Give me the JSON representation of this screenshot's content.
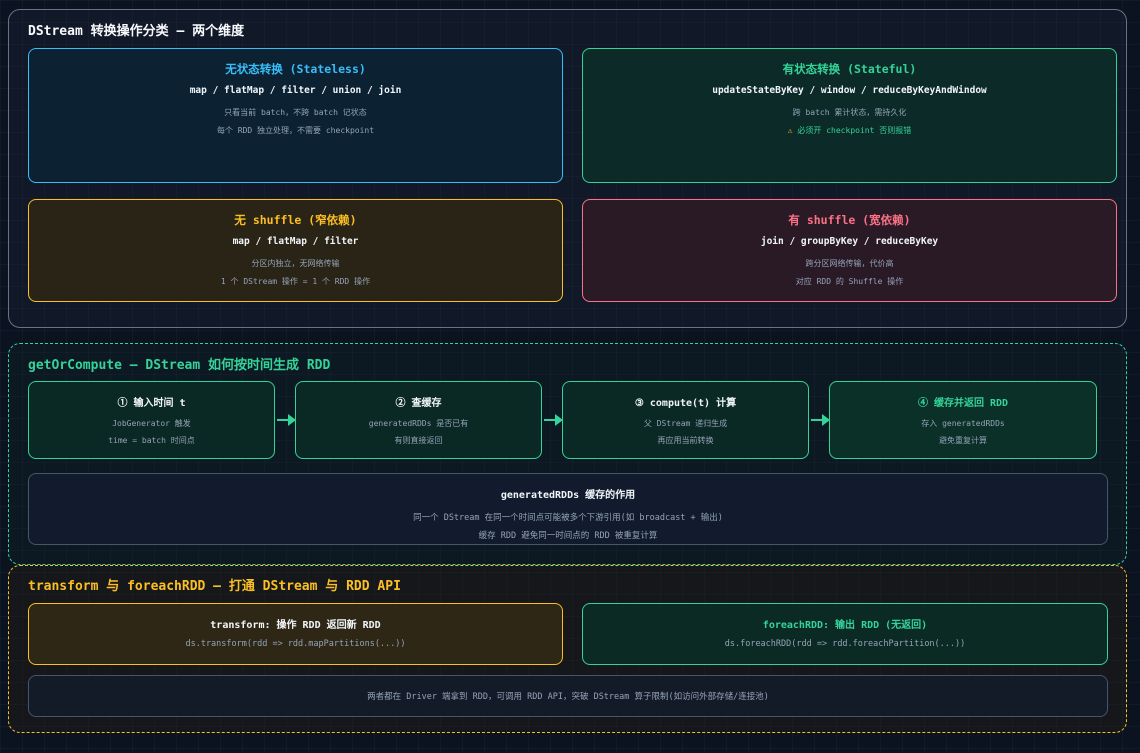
{
  "section1": {
    "title": "DStream 转换操作分类 — 两个维度",
    "cards": [
      {
        "title": "无状态转换 (Stateless)",
        "subtitle": "map / flatMap / filter / union / join",
        "lines": [
          "只看当前 batch，不跨 batch 记状态",
          "每个 RDD 独立处理，不需要 checkpoint"
        ]
      },
      {
        "title": "有状态转换 (Stateful)",
        "subtitle": "updateStateByKey / window / reduceByKeyAndWindow",
        "lines": [
          "跨 batch 累计状态，需持久化",
          "必须开 checkpoint 否则报错"
        ]
      },
      {
        "title": "无 shuffle (窄依赖)",
        "subtitle": "map / flatMap / filter",
        "lines": [
          "分区内独立，无网络传输",
          "1 个 DStream 操作 = 1 个 RDD 操作"
        ]
      },
      {
        "title": "有 shuffle (宽依赖)",
        "subtitle": "join / groupByKey / reduceByKey",
        "lines": [
          "跨分区网络传输，代价高",
          "对应 RDD 的 Shuffle 操作"
        ]
      }
    ]
  },
  "section2": {
    "title": "getOrCompute — DStream 如何按时间生成 RDD",
    "steps": [
      {
        "title": "① 输入时间 t",
        "lines": [
          "JobGenerator 触发",
          "time = batch 时间点"
        ]
      },
      {
        "title": "② 查缓存",
        "lines": [
          "generatedRDDs 是否已有",
          "有则直接返回"
        ]
      },
      {
        "title": "③ compute(t) 计算",
        "lines": [
          "父 DStream 递归生成",
          "再应用当前转换"
        ]
      },
      {
        "title": "④ 缓存并返回 RDD",
        "lines": [
          "存入 generatedRDDs",
          "避免重复计算"
        ]
      }
    ],
    "note": {
      "title": "generatedRDDs 缓存的作用",
      "lines": [
        "同一个 DStream 在同一个时间点可能被多个下游引用(如 broadcast + 输出)",
        "缓存 RDD 避免同一时间点的 RDD 被重复计算"
      ]
    }
  },
  "section3": {
    "title": "transform 与 foreachRDD — 打通 DStream 与 RDD API",
    "cards": [
      {
        "title": "transform: 操作 RDD 返回新 RDD",
        "code": "ds.transform(rdd => rdd.mapPartitions(...))"
      },
      {
        "title": "foreachRDD: 输出 RDD (无返回)",
        "code": "ds.foreachRDD(rdd => rdd.foreachPartition(...))"
      }
    ],
    "note": "两者都在 Driver 端拿到 RDD，可调用 RDD API，突破 DStream 算子限制(如访问外部存储/连接池)"
  },
  "icons": {
    "warning": "warning-icon",
    "arrow": "arrow-right-icon"
  },
  "colors": {
    "cyan": "#38bdf8",
    "green": "#34d399",
    "amber": "#fbbf24",
    "red": "#fb7185"
  }
}
